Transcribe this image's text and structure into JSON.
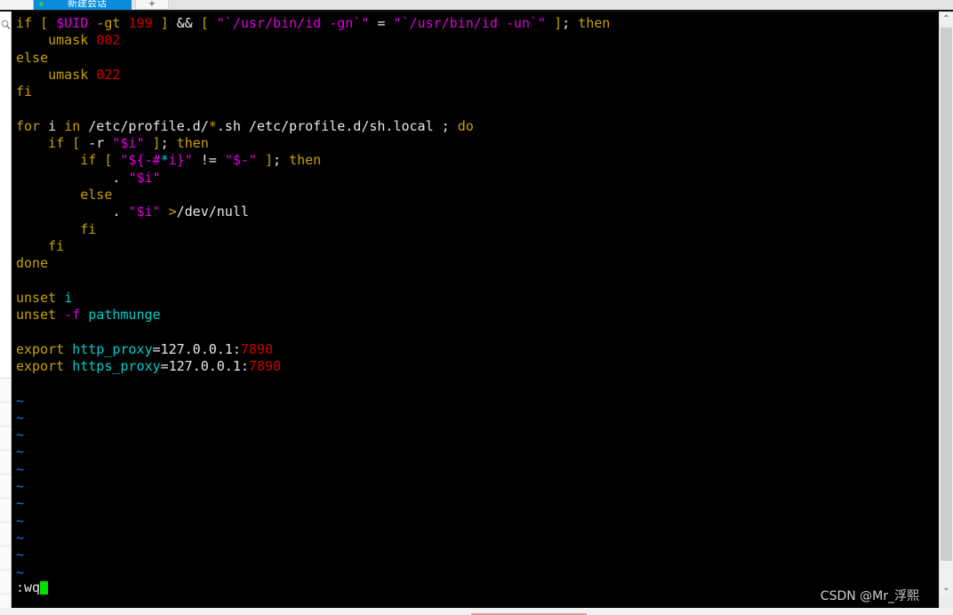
{
  "window": {
    "tab_label": "新建会话",
    "new_tab_label": "+",
    "status_dot_color": "#2ecc40",
    "active_tab_color": "#0a8cdd"
  },
  "sidebar": {
    "search_icon": "search-icon",
    "row_count": 10
  },
  "terminal": {
    "background": "#000000",
    "font_size_px": 15,
    "line_height_px": 19.3,
    "colors": {
      "keyword": "#c8a000",
      "variable": "#e000e0",
      "number": "#cc0000",
      "identifier": "#00cdcd",
      "plain": "#e6e6e6",
      "tilde": "#0f7fe0",
      "cursor": "#00e000"
    },
    "lines": [
      {
        "id": "l1",
        "spans": [
          {
            "t": "if",
            "c": "yel"
          },
          {
            "t": " ",
            "c": "wht"
          },
          {
            "t": "[",
            "c": "yel"
          },
          {
            "t": " ",
            "c": "wht"
          },
          {
            "t": "$UID",
            "c": "mag"
          },
          {
            "t": " ",
            "c": "wht"
          },
          {
            "t": "-gt",
            "c": "yel"
          },
          {
            "t": " ",
            "c": "wht"
          },
          {
            "t": "199",
            "c": "red"
          },
          {
            "t": " ",
            "c": "wht"
          },
          {
            "t": "]",
            "c": "yel"
          },
          {
            "t": " ",
            "c": "wht"
          },
          {
            "t": "&&",
            "c": "wht"
          },
          {
            "t": " ",
            "c": "wht"
          },
          {
            "t": "[",
            "c": "yel"
          },
          {
            "t": " ",
            "c": "wht"
          },
          {
            "t": "\"`/usr/bin/id -gn`\"",
            "c": "mag"
          },
          {
            "t": " ",
            "c": "wht"
          },
          {
            "t": "=",
            "c": "wht"
          },
          {
            "t": " ",
            "c": "wht"
          },
          {
            "t": "\"`/usr/bin/id -un`\"",
            "c": "mag"
          },
          {
            "t": " ",
            "c": "wht"
          },
          {
            "t": "]",
            "c": "yel"
          },
          {
            "t": ";",
            "c": "wht"
          },
          {
            "t": " ",
            "c": "wht"
          },
          {
            "t": "then",
            "c": "yel"
          }
        ]
      },
      {
        "id": "l2",
        "spans": [
          {
            "t": "    umask ",
            "c": "yel"
          },
          {
            "t": "002",
            "c": "red"
          }
        ]
      },
      {
        "id": "l3",
        "spans": [
          {
            "t": "else",
            "c": "yel"
          }
        ]
      },
      {
        "id": "l4",
        "spans": [
          {
            "t": "    umask ",
            "c": "yel"
          },
          {
            "t": "022",
            "c": "red"
          }
        ]
      },
      {
        "id": "l5",
        "spans": [
          {
            "t": "fi",
            "c": "yel"
          }
        ]
      },
      {
        "id": "l6",
        "spans": [
          {
            "t": "",
            "c": "wht"
          }
        ]
      },
      {
        "id": "l7",
        "spans": [
          {
            "t": "for",
            "c": "yel"
          },
          {
            "t": " ",
            "c": "wht"
          },
          {
            "t": "i",
            "c": "wht"
          },
          {
            "t": " ",
            "c": "wht"
          },
          {
            "t": "in",
            "c": "yel"
          },
          {
            "t": " /etc/profile.d/",
            "c": "wht"
          },
          {
            "t": "*",
            "c": "yel"
          },
          {
            "t": ".sh /etc/profile.d/sh.local ",
            "c": "wht"
          },
          {
            "t": ";",
            "c": "wht"
          },
          {
            "t": " ",
            "c": "wht"
          },
          {
            "t": "do",
            "c": "yel"
          }
        ]
      },
      {
        "id": "l8",
        "spans": [
          {
            "t": "    ",
            "c": "wht"
          },
          {
            "t": "if",
            "c": "yel"
          },
          {
            "t": " ",
            "c": "wht"
          },
          {
            "t": "[",
            "c": "yel"
          },
          {
            "t": " -r ",
            "c": "wht"
          },
          {
            "t": "\"$i\"",
            "c": "mag"
          },
          {
            "t": " ",
            "c": "wht"
          },
          {
            "t": "]",
            "c": "yel"
          },
          {
            "t": ";",
            "c": "wht"
          },
          {
            "t": " ",
            "c": "wht"
          },
          {
            "t": "then",
            "c": "yel"
          }
        ]
      },
      {
        "id": "l9",
        "spans": [
          {
            "t": "        ",
            "c": "wht"
          },
          {
            "t": "if",
            "c": "yel"
          },
          {
            "t": " ",
            "c": "wht"
          },
          {
            "t": "[",
            "c": "yel"
          },
          {
            "t": " ",
            "c": "wht"
          },
          {
            "t": "\"${-#",
            "c": "mag"
          },
          {
            "t": "*",
            "c": "cyn"
          },
          {
            "t": "i}\"",
            "c": "mag"
          },
          {
            "t": " !=",
            "c": "wht"
          },
          {
            "t": " ",
            "c": "wht"
          },
          {
            "t": "\"$-\"",
            "c": "mag"
          },
          {
            "t": " ",
            "c": "wht"
          },
          {
            "t": "]",
            "c": "yel"
          },
          {
            "t": ";",
            "c": "wht"
          },
          {
            "t": " ",
            "c": "wht"
          },
          {
            "t": "then",
            "c": "yel"
          }
        ]
      },
      {
        "id": "l10",
        "spans": [
          {
            "t": "            . ",
            "c": "wht"
          },
          {
            "t": "\"$i\"",
            "c": "mag"
          }
        ]
      },
      {
        "id": "l11",
        "spans": [
          {
            "t": "        ",
            "c": "wht"
          },
          {
            "t": "else",
            "c": "yel"
          }
        ]
      },
      {
        "id": "l12",
        "spans": [
          {
            "t": "            . ",
            "c": "wht"
          },
          {
            "t": "\"$i\"",
            "c": "mag"
          },
          {
            "t": " ",
            "c": "wht"
          },
          {
            "t": ">",
            "c": "yel"
          },
          {
            "t": "/dev/null",
            "c": "wht"
          }
        ]
      },
      {
        "id": "l13",
        "spans": [
          {
            "t": "        ",
            "c": "wht"
          },
          {
            "t": "fi",
            "c": "yel"
          }
        ]
      },
      {
        "id": "l14",
        "spans": [
          {
            "t": "    ",
            "c": "wht"
          },
          {
            "t": "fi",
            "c": "yel"
          }
        ]
      },
      {
        "id": "l15",
        "spans": [
          {
            "t": "done",
            "c": "yel"
          }
        ]
      },
      {
        "id": "l16",
        "spans": [
          {
            "t": "",
            "c": "wht"
          }
        ]
      },
      {
        "id": "l17",
        "spans": [
          {
            "t": "unset",
            "c": "yel"
          },
          {
            "t": " ",
            "c": "wht"
          },
          {
            "t": "i",
            "c": "cyn"
          }
        ]
      },
      {
        "id": "l18",
        "spans": [
          {
            "t": "unset",
            "c": "yel"
          },
          {
            "t": " ",
            "c": "wht"
          },
          {
            "t": "-f",
            "c": "mag"
          },
          {
            "t": " ",
            "c": "wht"
          },
          {
            "t": "pathmunge",
            "c": "cyn"
          }
        ]
      },
      {
        "id": "l19",
        "spans": [
          {
            "t": "",
            "c": "wht"
          }
        ]
      },
      {
        "id": "l20",
        "spans": [
          {
            "t": "export",
            "c": "yel"
          },
          {
            "t": " ",
            "c": "wht"
          },
          {
            "t": "http_proxy",
            "c": "cyn"
          },
          {
            "t": "=127.0.0.1:",
            "c": "wht"
          },
          {
            "t": "7890",
            "c": "red"
          }
        ]
      },
      {
        "id": "l21",
        "spans": [
          {
            "t": "export",
            "c": "yel"
          },
          {
            "t": " ",
            "c": "wht"
          },
          {
            "t": "https_proxy",
            "c": "cyn"
          },
          {
            "t": "=127.0.0.1:",
            "c": "wht"
          },
          {
            "t": "7890",
            "c": "red"
          }
        ]
      },
      {
        "id": "l22",
        "spans": [
          {
            "t": "",
            "c": "wht"
          }
        ]
      },
      {
        "id": "l23",
        "spans": [
          {
            "t": "~",
            "c": "til"
          }
        ]
      },
      {
        "id": "l24",
        "spans": [
          {
            "t": "~",
            "c": "til"
          }
        ]
      },
      {
        "id": "l25",
        "spans": [
          {
            "t": "~",
            "c": "til"
          }
        ]
      },
      {
        "id": "l26",
        "spans": [
          {
            "t": "~",
            "c": "til"
          }
        ]
      },
      {
        "id": "l27",
        "spans": [
          {
            "t": "~",
            "c": "til"
          }
        ]
      },
      {
        "id": "l28",
        "spans": [
          {
            "t": "~",
            "c": "til"
          }
        ]
      },
      {
        "id": "l29",
        "spans": [
          {
            "t": "~",
            "c": "til"
          }
        ]
      },
      {
        "id": "l30",
        "spans": [
          {
            "t": "~",
            "c": "til"
          }
        ]
      },
      {
        "id": "l31",
        "spans": [
          {
            "t": "~",
            "c": "til"
          }
        ]
      },
      {
        "id": "l32",
        "spans": [
          {
            "t": "~",
            "c": "til"
          }
        ]
      },
      {
        "id": "l33",
        "spans": [
          {
            "t": "~",
            "c": "til"
          }
        ]
      }
    ],
    "command_line": ":wq"
  },
  "watermark": {
    "text": "CSDN @Mr_浮熙"
  },
  "scrollbar": {
    "up_arrow": "⌃",
    "down_arrow": "⌄",
    "corner_chevron": "⌄"
  }
}
